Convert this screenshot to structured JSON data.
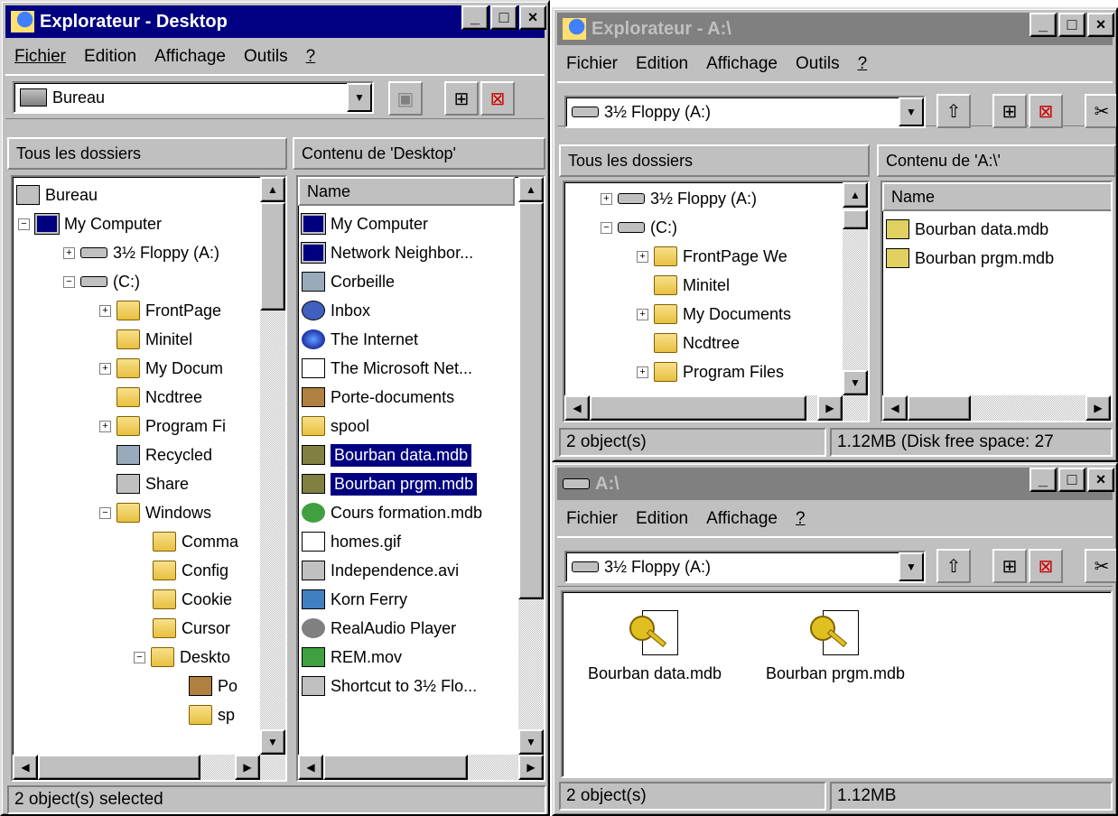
{
  "left": {
    "title": "Explorateur - Desktop",
    "menu": [
      "Fichier",
      "Edition",
      "Affichage",
      "Outils",
      "?"
    ],
    "address": "Bureau",
    "tree_header": "Tous les dossiers",
    "content_header": "Contenu de 'Desktop'",
    "tree": [
      "Bureau",
      "My Computer",
      "3½ Floppy (A:)",
      "(C:)",
      "FrontPage",
      "Minitel",
      "My Docum",
      "Ncdtree",
      "Program Fi",
      "Recycled",
      "Share",
      "Windows",
      "Comma",
      "Config",
      "Cookie",
      "Cursor",
      "Deskto",
      "Po",
      "sp"
    ],
    "column_name": "Name",
    "files": [
      "My Computer",
      "Network Neighbor...",
      "Corbeille",
      "Inbox",
      "The Internet",
      "The Microsoft Net...",
      "Porte-documents",
      "spool",
      "Bourban data.mdb",
      "Bourban prgm.mdb",
      "Cours formation.mdb",
      "homes.gif",
      "Independence.avi",
      "Korn Ferry",
      "RealAudio Player",
      "REM.mov",
      "Shortcut to 3½ Flo..."
    ],
    "status": "2 object(s) selected"
  },
  "right_top": {
    "title": "Explorateur - A:\\",
    "menu": [
      "Fichier",
      "Edition",
      "Affichage",
      "Outils",
      "?"
    ],
    "address": "3½ Floppy (A:)",
    "tree_header": "Tous les dossiers",
    "content_header": "Contenu de 'A:\\'",
    "tree": [
      "3½ Floppy (A:)",
      "(C:)",
      "FrontPage We",
      "Minitel",
      "My Documents",
      "Ncdtree",
      "Program Files"
    ],
    "column_name": "Name",
    "files": [
      "Bourban data.mdb",
      "Bourban prgm.mdb"
    ],
    "status_left": "2 object(s)",
    "status_right": "1.12MB (Disk free space: 27"
  },
  "right_bottom": {
    "title": "A:\\",
    "menu": [
      "Fichier",
      "Edition",
      "Affichage",
      "?"
    ],
    "address": "3½ Floppy (A:)",
    "icons": [
      "Bourban data.mdb",
      "Bourban prgm.mdb"
    ],
    "status_left": "2 object(s)",
    "status_right": "1.12MB"
  }
}
